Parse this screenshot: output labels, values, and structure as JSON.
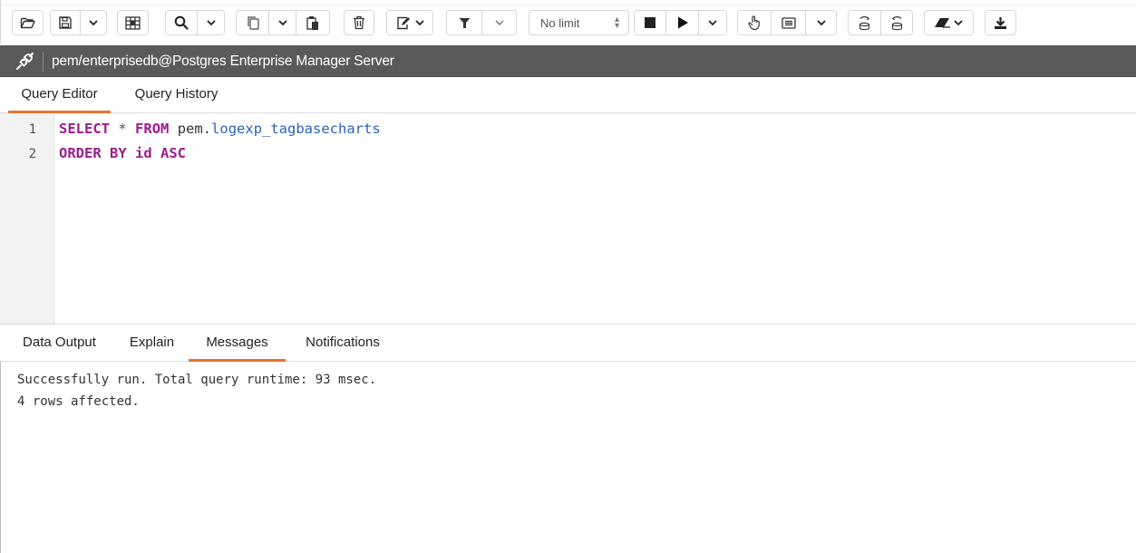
{
  "toolbar": {
    "buttons": [
      {
        "name": "open-file-icon"
      },
      {
        "name": "save-file-icon"
      },
      {
        "name": "save-dropdown-caret-icon"
      },
      {
        "name": "edit-grid-icon"
      },
      {
        "name": "find-icon"
      },
      {
        "name": "find-dropdown-caret-icon"
      },
      {
        "name": "copy-icon"
      },
      {
        "name": "copy-dropdown-caret-icon"
      },
      {
        "name": "paste-icon"
      },
      {
        "name": "delete-icon"
      },
      {
        "name": "edit-dropdown-icon"
      },
      {
        "name": "filter-icon"
      },
      {
        "name": "filter-dropdown-caret-icon"
      },
      {
        "name": "stop-icon"
      },
      {
        "name": "execute-icon"
      },
      {
        "name": "execute-dropdown-caret-icon"
      },
      {
        "name": "explain-icon"
      },
      {
        "name": "explain-analyze-icon"
      },
      {
        "name": "explain-dropdown-caret-icon"
      },
      {
        "name": "commit-icon"
      },
      {
        "name": "rollback-icon"
      },
      {
        "name": "clear-icon"
      },
      {
        "name": "download-icon"
      }
    ],
    "limit": {
      "label": "No limit"
    }
  },
  "connection": {
    "title": "pem/enterprisedb@Postgres Enterprise Manager Server"
  },
  "editor_tabs": [
    {
      "label": "Query Editor",
      "active": true
    },
    {
      "label": "Query History",
      "active": false
    }
  ],
  "editor": {
    "line_numbers": [
      "1",
      "2"
    ],
    "lines": [
      [
        {
          "text": "SELECT",
          "type": "kw"
        },
        {
          "text": " ",
          "type": "plain"
        },
        {
          "text": "*",
          "type": "op"
        },
        {
          "text": " ",
          "type": "plain"
        },
        {
          "text": "FROM",
          "type": "kw"
        },
        {
          "text": " pem.",
          "type": "plain"
        },
        {
          "text": "logexp_tagbasecharts",
          "type": "ident"
        }
      ],
      [
        {
          "text": "ORDER BY",
          "type": "kw"
        },
        {
          "text": " ",
          "type": "plain"
        },
        {
          "text": "id",
          "type": "kw"
        },
        {
          "text": " ",
          "type": "plain"
        },
        {
          "text": "ASC",
          "type": "kw"
        }
      ]
    ]
  },
  "result_tabs": [
    {
      "label": "Data Output",
      "active": false
    },
    {
      "label": "Explain",
      "active": false
    },
    {
      "label": "Messages",
      "active": true
    },
    {
      "label": "Notifications",
      "active": false
    }
  ],
  "messages": {
    "line1": "Successfully run. Total query runtime: 93 msec.",
    "line2": "4 rows affected."
  },
  "colors": {
    "accent": "#e8732b",
    "connbar": "#5a5a5a",
    "keyword": "#9b1d8c",
    "identifier": "#2b62b8"
  }
}
